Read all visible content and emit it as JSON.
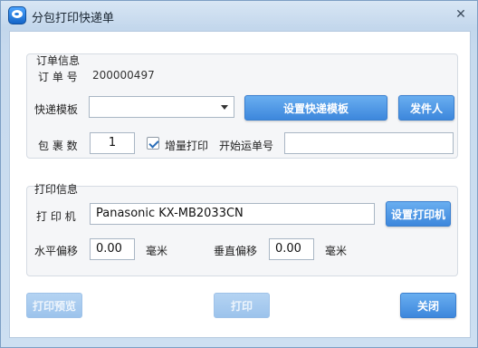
{
  "window": {
    "title": "分包打印快递单",
    "close_glyph": "✕"
  },
  "order_group": {
    "title": "订单信息",
    "order_no_label": "订 单 号",
    "order_no_value": "200000497",
    "template_label": "快递模板",
    "template_value": "",
    "set_template_button": "设置快递模板",
    "sender_button": "发件人",
    "packages_label": "包 裹 数",
    "packages_value": "1",
    "incremental_print_label": "增量打印",
    "incremental_print_checked": true,
    "start_waybill_label": "开始运单号",
    "start_waybill_value": ""
  },
  "print_group": {
    "title": "打印信息",
    "printer_label": "打 印 机",
    "printer_value": "Panasonic KX-MB2033CN",
    "set_printer_button": "设置打印机",
    "h_offset_label": "水平偏移",
    "h_offset_value": "0.00",
    "h_offset_unit": "毫米",
    "v_offset_label": "垂直偏移",
    "v_offset_value": "0.00",
    "v_offset_unit": "毫米"
  },
  "footer": {
    "preview_button": "打印预览",
    "print_button": "打印",
    "close_button": "关闭"
  },
  "colors": {
    "accent": "#4a95e3",
    "accent_disabled": "#a8cbef",
    "title_bar": "#c8dbef"
  },
  "icons": {
    "app_icon": "chat-bubble-app-icon",
    "dropdown": "chevron-down-icon",
    "checkbox": "checkmark-icon"
  }
}
